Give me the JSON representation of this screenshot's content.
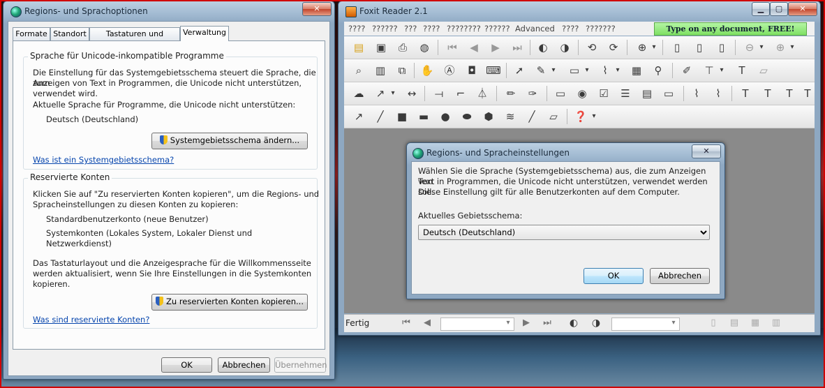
{
  "left_window": {
    "title": "Regions- und Sprachoptionen",
    "controls": {
      "minimize": "",
      "close": "✕"
    },
    "tabs": [
      {
        "label": "Formate"
      },
      {
        "label": "Standort"
      },
      {
        "label": "Tastaturen und Sprachen"
      },
      {
        "label": "Verwaltung"
      }
    ],
    "group_unicode": {
      "label": "Sprache für Unicode-inkompatible Programme",
      "description_line1": "Die Einstellung für das Systemgebietsschema steuert die Sprache, die zum",
      "description_line2": "Anzeigen von Text in Programmen, die Unicode nicht unterstützen,",
      "description_line3": "verwendet wird.",
      "current_label": "Aktuelle Sprache für Programme, die Unicode nicht unterstützen:",
      "current_value": "Deutsch (Deutschland)",
      "change_button": "Systemgebietsschema ändern...",
      "help_link": "Was ist ein Systemgebietsschema?"
    },
    "group_accounts": {
      "label": "Reservierte Konten",
      "description_line1": "Klicken Sie auf \"Zu reservierten Konten kopieren\", um die Regions- und",
      "description_line2": "Spracheinstellungen zu diesen Konten zu kopieren:",
      "item1": "Standardbenutzerkonto (neue Benutzer)",
      "item2_line1": "Systemkonten (Lokales System, Lokaler Dienst und",
      "item2_line2": "Netzwerkdienst)",
      "note_line1": "Das Tastaturlayout und die Anzeigesprache für die Willkommensseite",
      "note_line2": "werden aktualisiert, wenn Sie Ihre Einstellungen in die Systemkonten",
      "note_line3": "kopieren.",
      "copy_button": "Zu reservierten Konten kopieren...",
      "help_link": "Was sind reservierte Konten?"
    },
    "buttons": {
      "ok": "OK",
      "cancel": "Abbrechen",
      "apply": "Übernehmen"
    }
  },
  "foxit": {
    "title": "Foxit Reader 2.1",
    "controls": {
      "minimize": "▁",
      "maximize": "▢",
      "close": "✕"
    },
    "menu": [
      "????",
      "??????",
      "???",
      "????",
      "????????",
      "??????",
      "Advanced",
      "????",
      "???????"
    ],
    "ad_banner": "Type on any document, FREE!",
    "status_text": "Fertig"
  },
  "region_dialog": {
    "title": "Regions- und Spracheinstellungen",
    "close": "✕",
    "description_line1": "Wählen Sie die Sprache (Systemgebietsschema) aus, die zum Anzeigen von",
    "description_line2": "Text in Programmen, die Unicode nicht unterstützen, verwendet werden soll.",
    "description_line3": "Diese Einstellung gilt für alle Benutzerkonten auf dem Computer.",
    "locale_label": "Aktuelles Gebietsschema:",
    "locale_value": "Deutsch (Deutschland)",
    "ok": "OK",
    "cancel": "Abbrechen"
  }
}
